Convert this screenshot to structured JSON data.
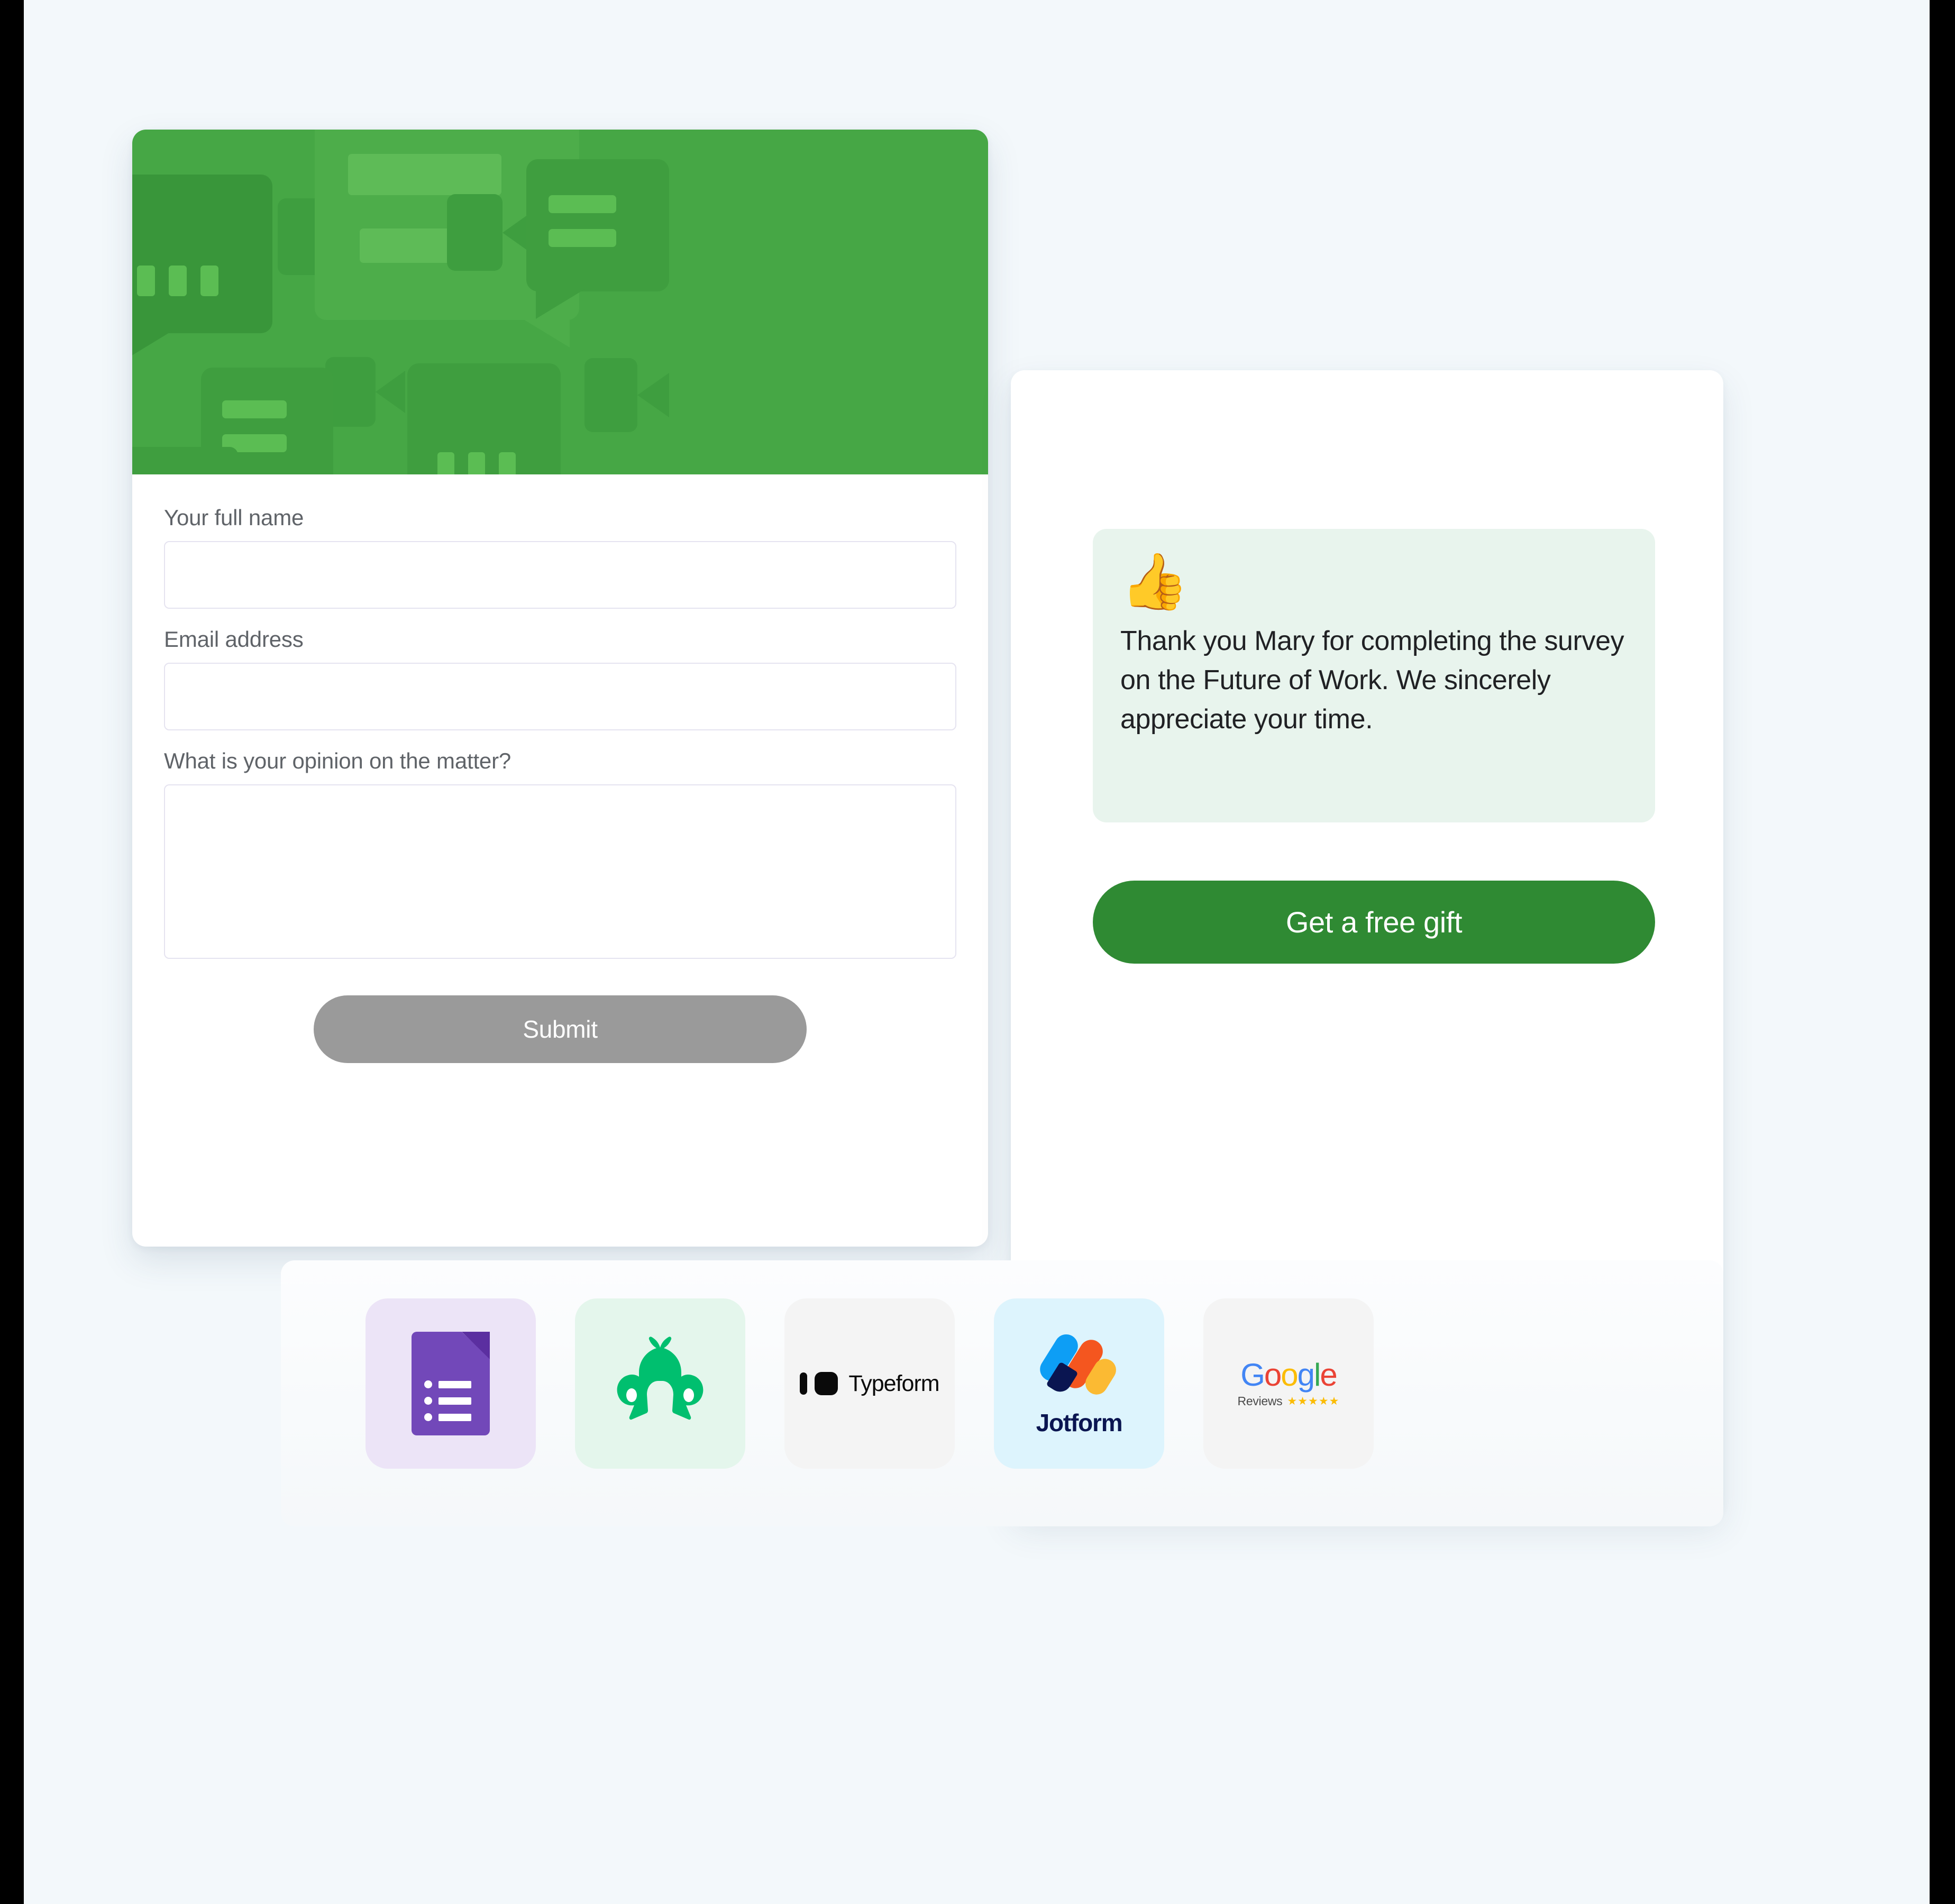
{
  "form": {
    "banner_color": "#46a745",
    "fields": [
      {
        "label": "Your full name",
        "value": "",
        "placeholder": "",
        "type": "text"
      },
      {
        "label": "Email address",
        "value": "",
        "placeholder": "",
        "type": "text"
      },
      {
        "label": "What is your opinion on the matter?",
        "value": "",
        "placeholder": "",
        "type": "textarea"
      }
    ],
    "submit_label": "Submit",
    "submit_color": "#9a9a9a"
  },
  "thankyou": {
    "icon": "thumbs-up-emoji",
    "icon_glyph": "👍",
    "message": "Thank you Mary for completing the survey on the  Future of Work. We sincerely appreciate your time.",
    "message_bg": "#e8f4ed",
    "cta_label": "Get a free gift",
    "cta_color": "#2f8a33"
  },
  "integrations": [
    {
      "name": "Google Forms",
      "icon": "google-forms-icon",
      "tile_bg": "#ece4f7"
    },
    {
      "name": "SurveyMonkey",
      "icon": "surveymonkey-icon",
      "tile_bg": "#e4f6ec"
    },
    {
      "name": "Typeform",
      "icon": "typeform-icon",
      "label": "Typeform",
      "tile_bg": "#f4f4f4"
    },
    {
      "name": "Jotform",
      "icon": "jotform-icon",
      "label": "Jotform",
      "tile_bg": "#ddf4fd"
    },
    {
      "name": "Google Reviews",
      "icon": "google-reviews-icon",
      "label_primary": "Google",
      "label_secondary": "Reviews",
      "stars": "★★★★★",
      "tile_bg": "#f4f4f4"
    }
  ],
  "google_wordmark": {
    "g1": "G",
    "o1": "o",
    "o2": "o",
    "g2": "g",
    "l": "l",
    "e": "e"
  },
  "colors": {
    "page_bg": "#f3f8fb",
    "banner_green": "#46a745",
    "cta_green": "#2f8a33",
    "mint": "#e8f4ed",
    "label_gray": "#5f6368",
    "input_border": "#e5e3f0"
  }
}
